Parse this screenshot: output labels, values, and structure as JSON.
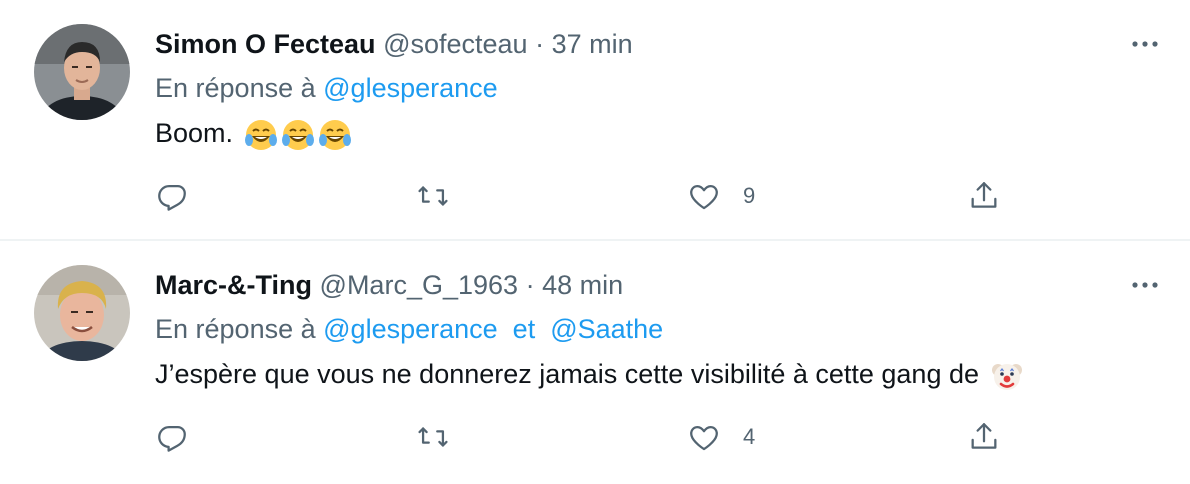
{
  "tweets": [
    {
      "display_name": "Simon O Fecteau",
      "handle": "@sofecteau",
      "separator": "·",
      "time": "37 min",
      "reply_prefix": "En réponse à",
      "reply_to": [
        "@glesperance"
      ],
      "reply_joiner": "",
      "text": "Boom.",
      "emojis": [
        "tears-of-joy-emoji",
        "tears-of-joy-emoji",
        "tears-of-joy-emoji"
      ],
      "like_count": "9"
    },
    {
      "display_name": "Marc-&-Ting",
      "handle": "@Marc_G_1963",
      "separator": "·",
      "time": "48 min",
      "reply_prefix": "En réponse à",
      "reply_to": [
        "@glesperance",
        "@Saathe"
      ],
      "reply_joiner": "et",
      "text": "J’espère que vous ne donnerez jamais cette visibilité à cette gang de",
      "emojis": [
        "clown-face-emoji"
      ],
      "like_count": "4"
    }
  ],
  "colors": {
    "link": "#1d9bf0",
    "muted": "#536471",
    "text": "#0f1419",
    "divider": "#eff3f4"
  },
  "icons": [
    "more-icon",
    "reply-icon",
    "retweet-icon",
    "like-icon",
    "share-icon"
  ]
}
